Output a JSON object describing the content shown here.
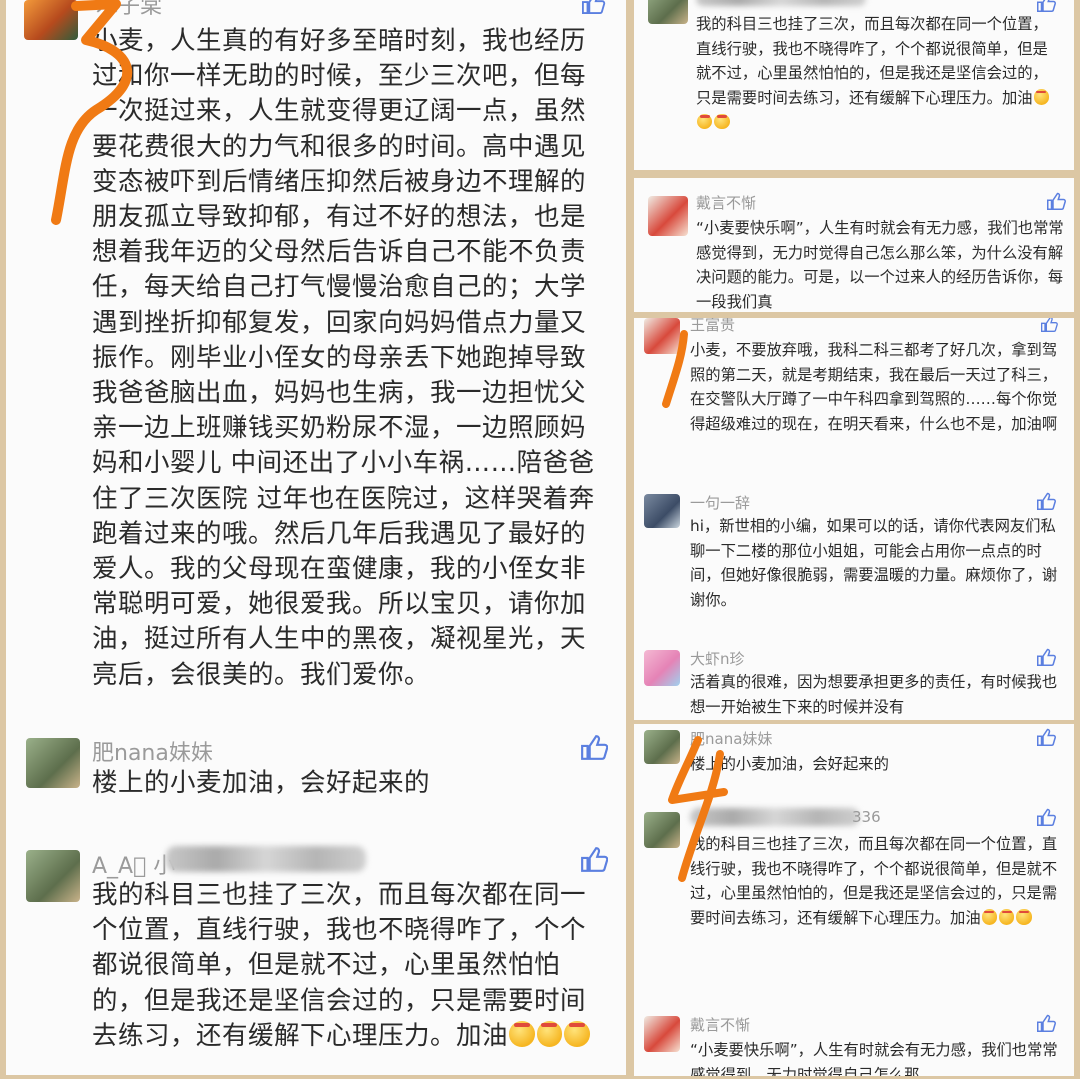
{
  "left": {
    "top_comment": {
      "username": "木子棠",
      "text": "小麦，人生真的有好多至暗时刻，我也经历过和你一样无助的时候，至少三次吧，但每一次挺过来，人生就变得更辽阔一点，虽然要花费很大的力气和很多的时间。高中遇见变态被吓到后情绪压抑然后被身边不理解的朋友孤立导致抑郁，有过不好的想法，也是想着我年迈的父母然后告诉自己不能不负责任，每天给自己打气慢慢治愈自己的；大学遇到挫折抑郁复发，回家向妈妈借点力量又振作。刚毕业小侄女的母亲丢下她跑掉导致我爸爸脑出血，妈妈也生病，我一边担忧父亲一边上班赚钱买奶粉尿不湿，一边照顾妈妈和小婴儿 中间还出了小小车祸……陪爸爸住了三次医院 过年也在医院过，这样哭着奔跑着过来的哦。然后几年后我遇见了最好的爱人。我的父母现在蛮健康，我的小侄女非常聪明可爱，她很爱我。所以宝贝，请你加油，挺过所有人生中的黑夜，凝视星光，天亮后，会很美的。我们爱你。"
    },
    "comment2": {
      "username": "肥nana妹妹",
      "text": "楼上的小麦加油，会好起来的"
    },
    "comment3": {
      "username_visible": "A_A\u0000 小",
      "text": "我的科目三也挂了三次，而且每次都在同一个位置，直线行驶，我也不晓得咋了，个个都说很简单，但是就不过，心里虽然怕怕的，但是我还是坚信会过的，只是需要时间去练习，还有缓解下心理压力。加油"
    },
    "scribble_number": "3"
  },
  "right_top": {
    "comment_a": {
      "text": "我的科目三也挂了三次，而且每次都在同一个位置，直线行驶，我也不晓得咋了，个个都说很简单，但是就不过，心里虽然怕怕的，但是我还是坚信会过的，只是需要时间去练习，还有缓解下心理压力。加油"
    }
  },
  "right_mid": {
    "comment_b": {
      "username": "戴言不惭",
      "text": "“小麦要快乐啊”，人生有时就会有无力感，我们也常常感觉得到，无力时觉得自己怎么那么笨，为什么没有解决问题的能力。可是，以一个过来人的经历告诉你，每一段我们真"
    }
  },
  "right_third": {
    "scribble_number": "1",
    "comments": [
      {
        "username": "王富贵",
        "text": "小麦，不要放弃哦，我科二科三都考了好几次，拿到驾照的第二天，就是考期结束，我在最后一天过了科三，在交警队大厅蹲了一中午科四拿到驾照的……每个你觉得超级难过的现在，在明天看来，什么也不是，加油啊"
      },
      {
        "username": "一句一辞",
        "text": "hi，新世相的小编，如果可以的话，请你代表网友们私聊一下二楼的那位小姐姐，可能会占用你一点点的时间，但她好像很脆弱，需要温暖的力量。麻烦你了，谢谢你。"
      },
      {
        "username": "大虾n珍",
        "text": "活着真的很难，因为想要承担更多的责任，有时候我也想一开始被生下来的时候并没有"
      }
    ]
  },
  "right_bottom": {
    "scribble_number": "4",
    "comments": [
      {
        "username": "肥nana妹妹",
        "text": "楼上的小麦加油，会好起来的"
      },
      {
        "username_visible": "336",
        "text": "我的科目三也挂了三次，而且每次都在同一个位置，直线行驶，我也不晓得咋了，个个都说很简单，但是就不过，心里虽然怕怕的，但是我还是坚信会过的，只是需要时间去练习，还有缓解下心理压力。加油"
      },
      {
        "username": "戴言不惭",
        "text": "“小麦要快乐啊”，人生有时就会有无力感，我们也常常感觉得到，无力时觉得自己怎么那"
      }
    ]
  },
  "colors": {
    "scribble": "#f07a14",
    "like_icon": "#5b7fe0",
    "frame": "#dcc7a4"
  }
}
